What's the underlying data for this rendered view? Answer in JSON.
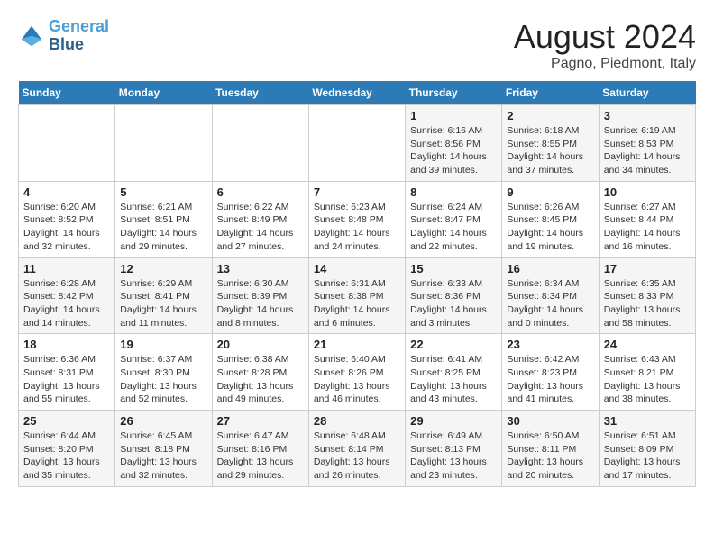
{
  "logo": {
    "line1": "General",
    "line2": "Blue"
  },
  "title": "August 2024",
  "subtitle": "Pagno, Piedmont, Italy",
  "days_of_week": [
    "Sunday",
    "Monday",
    "Tuesday",
    "Wednesday",
    "Thursday",
    "Friday",
    "Saturday"
  ],
  "weeks": [
    [
      {
        "day": "",
        "info": ""
      },
      {
        "day": "",
        "info": ""
      },
      {
        "day": "",
        "info": ""
      },
      {
        "day": "",
        "info": ""
      },
      {
        "day": "1",
        "info": "Sunrise: 6:16 AM\nSunset: 8:56 PM\nDaylight: 14 hours\nand 39 minutes."
      },
      {
        "day": "2",
        "info": "Sunrise: 6:18 AM\nSunset: 8:55 PM\nDaylight: 14 hours\nand 37 minutes."
      },
      {
        "day": "3",
        "info": "Sunrise: 6:19 AM\nSunset: 8:53 PM\nDaylight: 14 hours\nand 34 minutes."
      }
    ],
    [
      {
        "day": "4",
        "info": "Sunrise: 6:20 AM\nSunset: 8:52 PM\nDaylight: 14 hours\nand 32 minutes."
      },
      {
        "day": "5",
        "info": "Sunrise: 6:21 AM\nSunset: 8:51 PM\nDaylight: 14 hours\nand 29 minutes."
      },
      {
        "day": "6",
        "info": "Sunrise: 6:22 AM\nSunset: 8:49 PM\nDaylight: 14 hours\nand 27 minutes."
      },
      {
        "day": "7",
        "info": "Sunrise: 6:23 AM\nSunset: 8:48 PM\nDaylight: 14 hours\nand 24 minutes."
      },
      {
        "day": "8",
        "info": "Sunrise: 6:24 AM\nSunset: 8:47 PM\nDaylight: 14 hours\nand 22 minutes."
      },
      {
        "day": "9",
        "info": "Sunrise: 6:26 AM\nSunset: 8:45 PM\nDaylight: 14 hours\nand 19 minutes."
      },
      {
        "day": "10",
        "info": "Sunrise: 6:27 AM\nSunset: 8:44 PM\nDaylight: 14 hours\nand 16 minutes."
      }
    ],
    [
      {
        "day": "11",
        "info": "Sunrise: 6:28 AM\nSunset: 8:42 PM\nDaylight: 14 hours\nand 14 minutes."
      },
      {
        "day": "12",
        "info": "Sunrise: 6:29 AM\nSunset: 8:41 PM\nDaylight: 14 hours\nand 11 minutes."
      },
      {
        "day": "13",
        "info": "Sunrise: 6:30 AM\nSunset: 8:39 PM\nDaylight: 14 hours\nand 8 minutes."
      },
      {
        "day": "14",
        "info": "Sunrise: 6:31 AM\nSunset: 8:38 PM\nDaylight: 14 hours\nand 6 minutes."
      },
      {
        "day": "15",
        "info": "Sunrise: 6:33 AM\nSunset: 8:36 PM\nDaylight: 14 hours\nand 3 minutes."
      },
      {
        "day": "16",
        "info": "Sunrise: 6:34 AM\nSunset: 8:34 PM\nDaylight: 14 hours\nand 0 minutes."
      },
      {
        "day": "17",
        "info": "Sunrise: 6:35 AM\nSunset: 8:33 PM\nDaylight: 13 hours\nand 58 minutes."
      }
    ],
    [
      {
        "day": "18",
        "info": "Sunrise: 6:36 AM\nSunset: 8:31 PM\nDaylight: 13 hours\nand 55 minutes."
      },
      {
        "day": "19",
        "info": "Sunrise: 6:37 AM\nSunset: 8:30 PM\nDaylight: 13 hours\nand 52 minutes."
      },
      {
        "day": "20",
        "info": "Sunrise: 6:38 AM\nSunset: 8:28 PM\nDaylight: 13 hours\nand 49 minutes."
      },
      {
        "day": "21",
        "info": "Sunrise: 6:40 AM\nSunset: 8:26 PM\nDaylight: 13 hours\nand 46 minutes."
      },
      {
        "day": "22",
        "info": "Sunrise: 6:41 AM\nSunset: 8:25 PM\nDaylight: 13 hours\nand 43 minutes."
      },
      {
        "day": "23",
        "info": "Sunrise: 6:42 AM\nSunset: 8:23 PM\nDaylight: 13 hours\nand 41 minutes."
      },
      {
        "day": "24",
        "info": "Sunrise: 6:43 AM\nSunset: 8:21 PM\nDaylight: 13 hours\nand 38 minutes."
      }
    ],
    [
      {
        "day": "25",
        "info": "Sunrise: 6:44 AM\nSunset: 8:20 PM\nDaylight: 13 hours\nand 35 minutes."
      },
      {
        "day": "26",
        "info": "Sunrise: 6:45 AM\nSunset: 8:18 PM\nDaylight: 13 hours\nand 32 minutes."
      },
      {
        "day": "27",
        "info": "Sunrise: 6:47 AM\nSunset: 8:16 PM\nDaylight: 13 hours\nand 29 minutes."
      },
      {
        "day": "28",
        "info": "Sunrise: 6:48 AM\nSunset: 8:14 PM\nDaylight: 13 hours\nand 26 minutes."
      },
      {
        "day": "29",
        "info": "Sunrise: 6:49 AM\nSunset: 8:13 PM\nDaylight: 13 hours\nand 23 minutes."
      },
      {
        "day": "30",
        "info": "Sunrise: 6:50 AM\nSunset: 8:11 PM\nDaylight: 13 hours\nand 20 minutes."
      },
      {
        "day": "31",
        "info": "Sunrise: 6:51 AM\nSunset: 8:09 PM\nDaylight: 13 hours\nand 17 minutes."
      }
    ]
  ]
}
